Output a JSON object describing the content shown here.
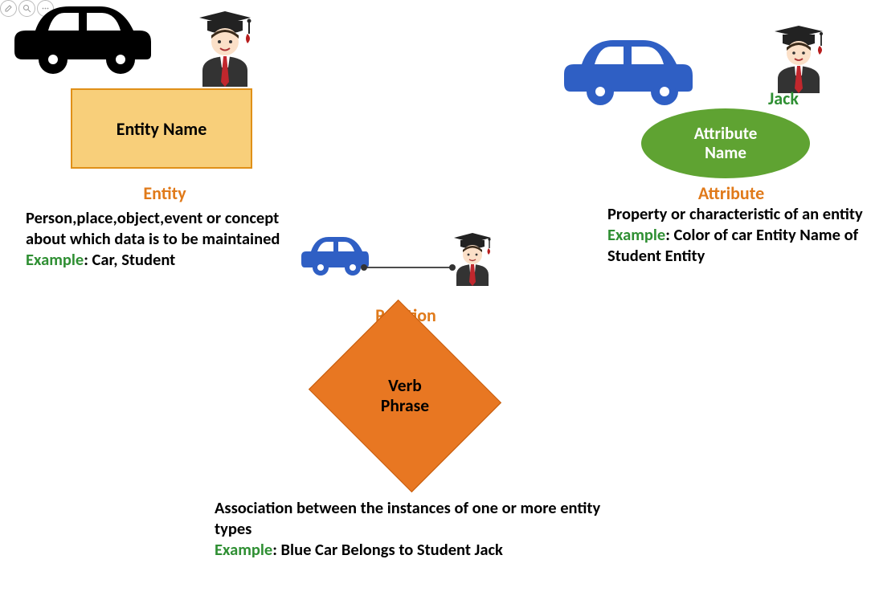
{
  "entity": {
    "shape_label": "Entity Name",
    "heading": "Entity",
    "description": "Person,place,object,event or concept about which data is to be maintained",
    "example_label": "Example",
    "example_text": ": Car, Student"
  },
  "relation": {
    "shape_label_line1": "Verb",
    "shape_label_line2": "Phrase",
    "heading": "Relation",
    "description": "Association between the instances of one or more entity types",
    "example_label": "Example",
    "example_text": ": Blue Car Belongs to Student Jack"
  },
  "attribute": {
    "shape_label_line1": "Attribute",
    "shape_label_line2": "Name",
    "heading": "Attribute",
    "person_name": "Jack",
    "description": "Property or characteristic of an entity",
    "example_label": "Example",
    "example_text": ": Color of car Entity Name of Student Entity"
  }
}
